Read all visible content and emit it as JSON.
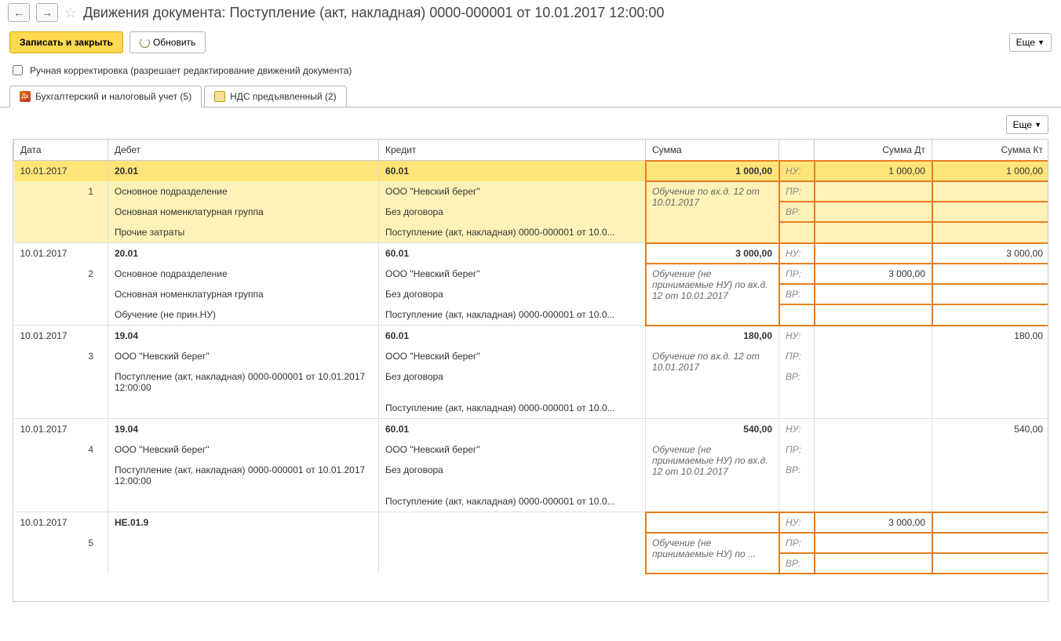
{
  "header": {
    "title": "Движения документа: Поступление (акт, накладная) 0000-000001 от 10.01.2017 12:00:00"
  },
  "toolbar": {
    "save_close": "Записать и закрыть",
    "refresh": "Обновить",
    "more": "Еще"
  },
  "checkbox": {
    "manual_correction": "Ручная корректировка (разрешает редактирование движений документа)"
  },
  "tabs": {
    "tab1": "Бухгалтерский и налоговый учет (5)",
    "tab2": "НДС предъявленный (2)"
  },
  "columns": {
    "date": "Дата",
    "debit": "Дебет",
    "credit": "Кредит",
    "sum": "Сумма",
    "sum_dt": "Сумма Дт",
    "sum_kt": "Сумма Кт"
  },
  "labels": {
    "nu": "НУ:",
    "pr": "ПР:",
    "vr": "ВР:"
  },
  "rows": [
    {
      "date": "10.01.2017",
      "idx": "1",
      "debit_acc": "20.01",
      "credit_acc": "60.01",
      "sum": "1 000,00",
      "sum_dt": "1 000,00",
      "sum_kt": "1 000,00",
      "debit_lines": [
        "Основное подразделение",
        "Основная номенклатурная группа",
        "Прочие затраты"
      ],
      "credit_lines": [
        "ООО \"Невский берег\"",
        "Без договора",
        "Поступление (акт, накладная) 0000-000001 от 10.0..."
      ],
      "desc": "Обучение по вх.д. 12 от 10.01.2017",
      "pr_dt": "",
      "vr_dt": "",
      "highlighted": true,
      "orange": true
    },
    {
      "date": "10.01.2017",
      "idx": "2",
      "debit_acc": "20.01",
      "credit_acc": "60.01",
      "sum": "3 000,00",
      "sum_dt": "",
      "sum_kt": "3 000,00",
      "pr_dt": "3 000,00",
      "debit_lines": [
        "Основное подразделение",
        "Основная номенклатурная группа",
        "Обучение (не прин.НУ)"
      ],
      "credit_lines": [
        "ООО \"Невский берег\"",
        "Без договора",
        "Поступление (акт, накладная) 0000-000001 от 10.0..."
      ],
      "desc": "Обучение (не принимаемые НУ) по вх.д. 12 от 10.01.2017",
      "highlighted": false,
      "orange": true
    },
    {
      "date": "10.01.2017",
      "idx": "3",
      "debit_acc": "19.04",
      "credit_acc": "60.01",
      "sum": "180,00",
      "sum_dt": "",
      "sum_kt": "180,00",
      "debit_lines": [
        "ООО \"Невский берег\"",
        "Поступление (акт, накладная) 0000-000001 от 10.01.2017 12:00:00"
      ],
      "credit_lines": [
        "ООО \"Невский берег\"",
        "Без договора",
        "Поступление (акт, накладная) 0000-000001 от 10.0..."
      ],
      "desc": "Обучение по вх.д. 12 от 10.01.2017",
      "highlighted": false,
      "orange": false
    },
    {
      "date": "10.01.2017",
      "idx": "4",
      "debit_acc": "19.04",
      "credit_acc": "60.01",
      "sum": "540,00",
      "sum_dt": "",
      "sum_kt": "540,00",
      "debit_lines": [
        "ООО \"Невский берег\"",
        "Поступление (акт, накладная) 0000-000001 от 10.01.2017 12:00:00"
      ],
      "credit_lines": [
        "ООО \"Невский берег\"",
        "Без договора",
        "Поступление (акт, накладная) 0000-000001 от 10.0..."
      ],
      "desc": "Обучение (не принимаемые НУ) по вх.д. 12 от 10.01.2017",
      "highlighted": false,
      "orange": false
    },
    {
      "date": "10.01.2017",
      "idx": "5",
      "debit_acc": "НЕ.01.9",
      "credit_acc": "",
      "sum": "",
      "sum_dt": "3 000,00",
      "sum_kt": "",
      "debit_lines": [
        "",
        ""
      ],
      "credit_lines": [
        "",
        ""
      ],
      "desc": "Обучение (не принимаемые НУ) по ...",
      "highlighted": false,
      "orange": true
    }
  ]
}
